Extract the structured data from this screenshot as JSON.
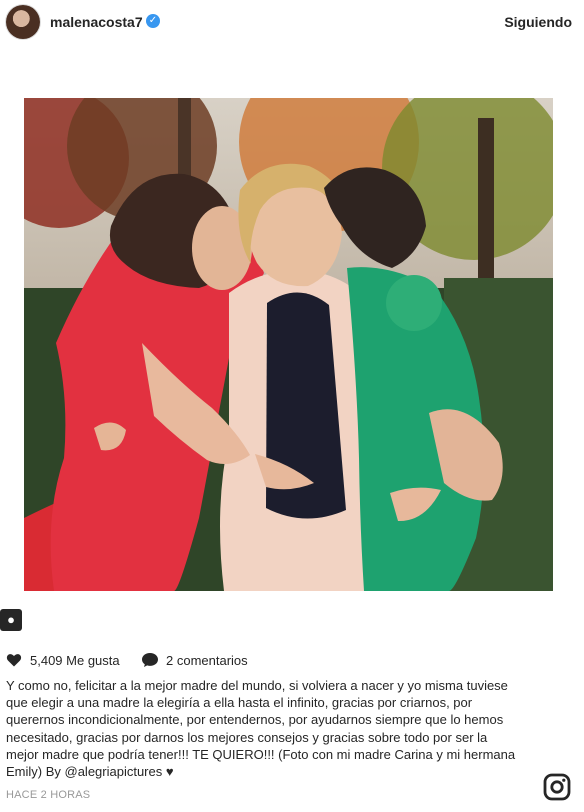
{
  "header": {
    "username": "malenacosta7",
    "follow_label": "Siguiendo"
  },
  "post": {
    "likes": "5,409 Me gusta",
    "comments": "2 comentarios",
    "caption_main": "Y como no, felicitar a la mejor madre del mundo, si volviera a nacer y yo misma tuviese que elegir a una madre la elegiría a ella hasta el infinito, gracias por criarnos, por querernos incondicionalmente, por entendernos, por ayudarnos siempre que lo hemos necesitado, gracias por darnos los mejores consejos y gracias sobre todo por ser la mejor madre que podría tener!!! TE QUIERO!!! (Foto con mi madre Carina y mi hermana Emily) By ",
    "mention": "@alegriapictures",
    "caption_end": " ♥",
    "timestamp": "HACE 2 HORAS"
  },
  "icons": {
    "verified": "verified-badge-icon",
    "tag": "user-tag-icon",
    "heart": "heart-icon",
    "comment": "comment-icon",
    "instagram": "instagram-logo-icon"
  },
  "colors": {
    "text": "#262626",
    "verified": "#3897f0",
    "muted": "#999999"
  }
}
